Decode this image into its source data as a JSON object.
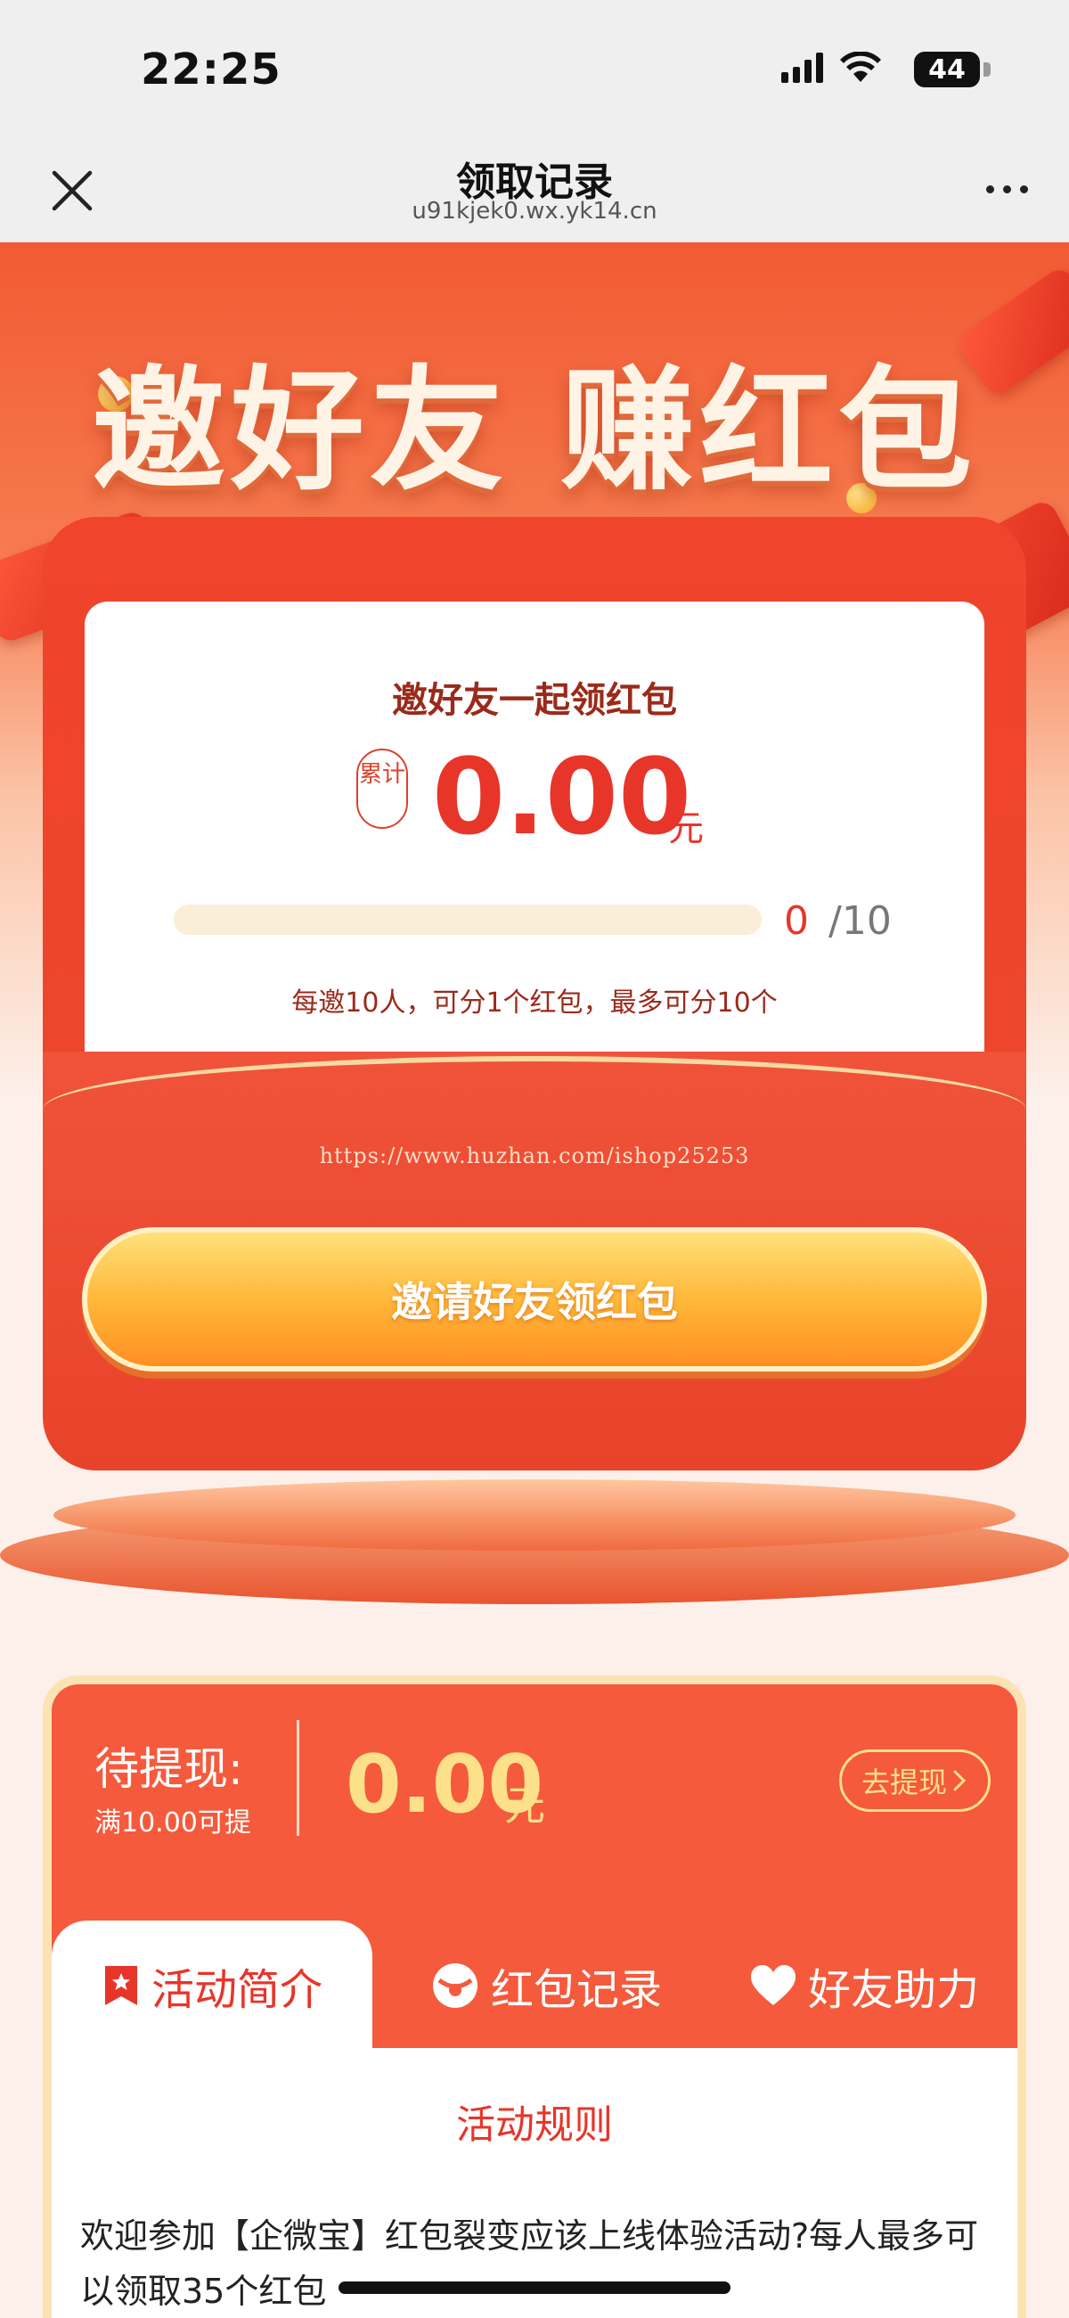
{
  "status_bar": {
    "time": "22:25",
    "battery": "44"
  },
  "nav": {
    "title": "领取记录",
    "url": "u91kjek0.wx.yk14.cn"
  },
  "hero": {
    "headline": "邀好友 赚红包"
  },
  "card": {
    "title": "邀好友一起领红包",
    "badge": "累计",
    "amount": "0.00",
    "unit": "元",
    "progress_current": "0",
    "progress_total": "/10",
    "progress_fraction": 0,
    "rule": "每邀10人，可分1个红包，最多可分10个"
  },
  "watermark": "https://www.huzhan.com/ishop25253",
  "invite_button": "邀请好友领红包",
  "wallet": {
    "label": "待提现:",
    "sub": "满10.00可提",
    "amount": "0.00",
    "unit": "元",
    "withdraw": "去提现"
  },
  "tabs": [
    {
      "label": "活动简介",
      "icon": "bookmark-icon"
    },
    {
      "label": "红包记录",
      "icon": "redpacket-icon"
    },
    {
      "label": "好友助力",
      "icon": "heart-icon"
    }
  ],
  "panel": {
    "title": "活动规则",
    "text": "欢迎参加【企微宝】红包裂变应该上线体验活动?每人最多可以领取35个红包"
  },
  "colors": {
    "primary_red": "#e8352a",
    "gold": "#fde08a",
    "orange": "#ff8f22"
  }
}
